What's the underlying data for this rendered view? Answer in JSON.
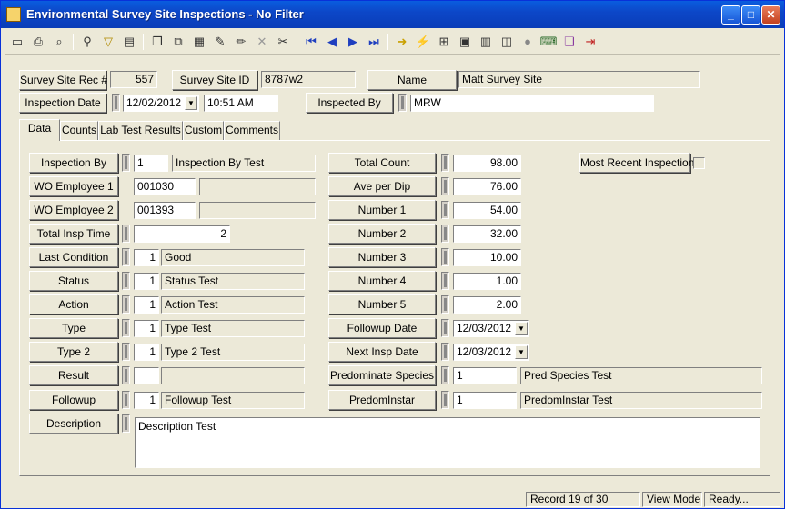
{
  "window": {
    "title": "Environmental Survey Site Inspections - No Filter",
    "min_glyph": "_",
    "max_glyph": "□",
    "close_glyph": "✕"
  },
  "toolbar": {
    "icons": [
      "new-record-icon",
      "print-icon",
      "print-preview-icon",
      "find-icon",
      "filter-icon",
      "form-view-icon",
      "copy-icon",
      "paste-icon",
      "delete-record-icon",
      "edit-icon",
      "pencil-icon",
      "cancel-icon",
      "cut-icon",
      "first-record-icon",
      "previous-record-icon",
      "next-record-icon",
      "last-record-icon",
      "go-to-icon",
      "calculate-icon",
      "tree-icon",
      "chart-icon",
      "calculator-icon",
      "map-icon",
      "globe-icon",
      "keyboard-icon",
      "book-icon",
      "exit-icon"
    ]
  },
  "header": {
    "rec_label": "Survey Site Rec #",
    "rec_value": "557",
    "site_id_label": "Survey Site ID",
    "site_id_value": "8787w2",
    "name_label": "Name",
    "name_value": "Matt Survey Site",
    "insp_date_label": "Inspection Date",
    "insp_date_value": "12/02/2012",
    "insp_time_value": "10:51 AM",
    "inspected_by_label": "Inspected By",
    "inspected_by_value": "MRW"
  },
  "tabs": [
    {
      "label": "Data"
    },
    {
      "label": "Counts"
    },
    {
      "label": "Lab Test Results"
    },
    {
      "label": "Custom"
    },
    {
      "label": "Comments"
    }
  ],
  "left": {
    "inspection_by": {
      "label": "Inspection By",
      "code": "1",
      "desc": "Inspection By Test"
    },
    "wo_emp1": {
      "label": "WO Employee 1",
      "code": "001030",
      "desc": ""
    },
    "wo_emp2": {
      "label": "WO Employee 2",
      "code": "001393",
      "desc": ""
    },
    "total_insp_time": {
      "label": "Total Insp Time",
      "value": "2"
    },
    "last_condition": {
      "label": "Last Condition",
      "code": "1",
      "desc": "Good"
    },
    "status": {
      "label": "Status",
      "code": "1",
      "desc": "Status Test"
    },
    "action": {
      "label": "Action",
      "code": "1",
      "desc": "Action Test"
    },
    "type": {
      "label": "Type",
      "code": "1",
      "desc": "Type Test"
    },
    "type2": {
      "label": "Type 2",
      "code": "1",
      "desc": "Type 2 Test"
    },
    "result": {
      "label": "Result",
      "code": "",
      "desc": ""
    },
    "followup": {
      "label": "Followup",
      "code": "1",
      "desc": "Followup Test"
    },
    "description": {
      "label": "Description",
      "value": "Description Test"
    }
  },
  "right": {
    "total_count": {
      "label": "Total Count",
      "value": "98.00"
    },
    "ave_per_dip": {
      "label": "Ave per Dip",
      "value": "76.00"
    },
    "number1": {
      "label": "Number 1",
      "value": "54.00"
    },
    "number2": {
      "label": "Number 2",
      "value": "32.00"
    },
    "number3": {
      "label": "Number 3",
      "value": "10.00"
    },
    "number4": {
      "label": "Number 4",
      "value": "1.00"
    },
    "number5": {
      "label": "Number 5",
      "value": "2.00"
    },
    "followup_date": {
      "label": "Followup Date",
      "value": "12/03/2012"
    },
    "next_insp_date": {
      "label": "Next Insp Date",
      "value": "12/03/2012"
    },
    "pred_species": {
      "label": "Predominate Species",
      "code": "1",
      "desc": "Pred Species Test"
    },
    "pred_instar": {
      "label": "PredomInstar",
      "code": "1",
      "desc": "PredomInstar Test"
    },
    "most_recent_label": "Most Recent Inspection",
    "most_recent_checked": false
  },
  "status_bar": {
    "record": "Record 19 of 30",
    "mode": "View Mode",
    "state": "Ready..."
  }
}
